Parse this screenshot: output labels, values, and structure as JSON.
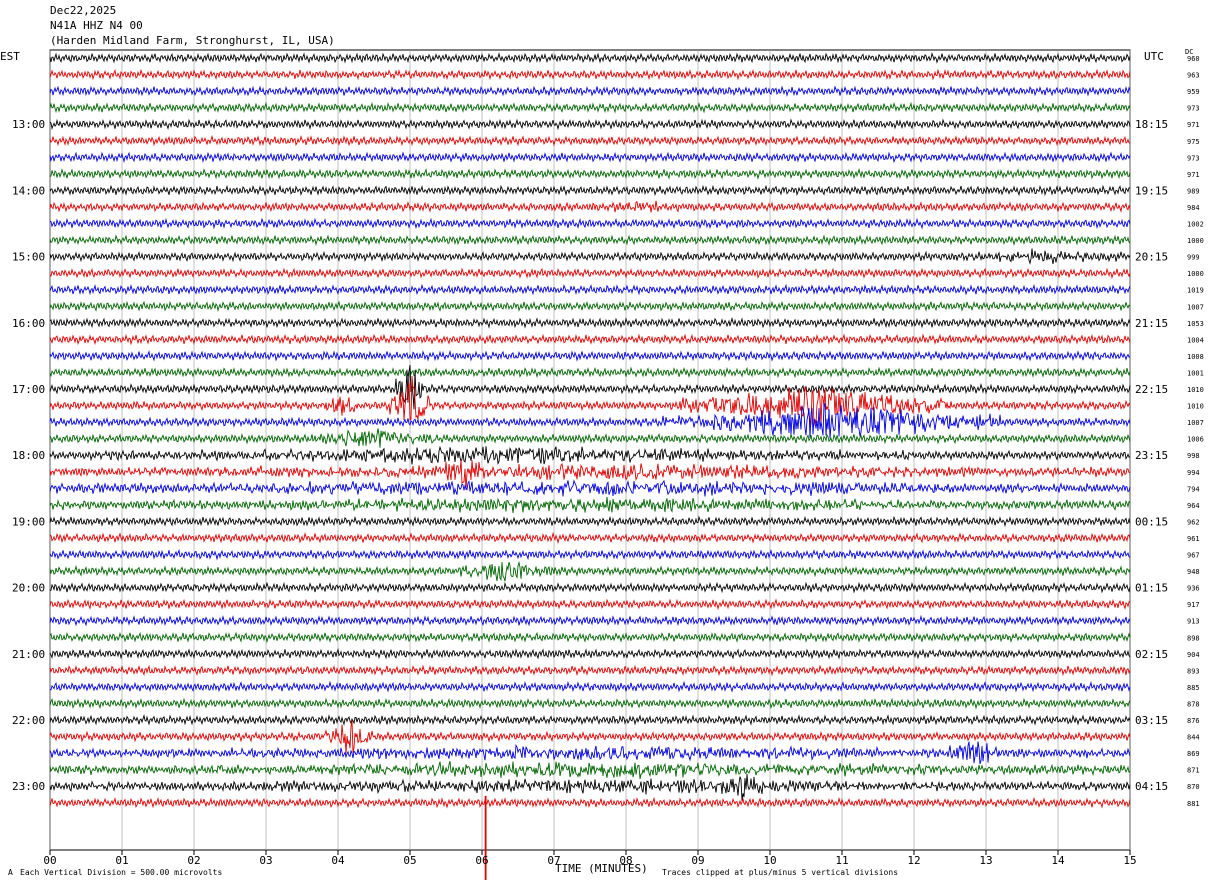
{
  "header": {
    "date": "Dec22,2025",
    "station": "N41A HHZ N4 00",
    "location": "(Harden Midland Farm, Stronghurst, IL, USA)"
  },
  "left_axis_label": "EST",
  "right_axis_label": "UTC",
  "dc_label": "DC",
  "footer": {
    "scale_note": "Each Vertical Division =  500.00 microvolts",
    "clip_note": "Traces clipped at plus/minus 5 vertical divisions",
    "corner_mark": "A"
  },
  "chart_data": {
    "type": "line",
    "title": "",
    "xlabel": "TIME (MINUTES)",
    "ylabel": "",
    "xlim": [
      0,
      15
    ],
    "x_ticks": [
      "00",
      "01",
      "02",
      "03",
      "04",
      "05",
      "06",
      "07",
      "08",
      "09",
      "10",
      "11",
      "12",
      "13",
      "14",
      "15"
    ],
    "traces_per_hour": 4,
    "minutes_per_trace": 15,
    "trace_colors": [
      "#000000",
      "#e00000",
      "#0000e0",
      "#006400"
    ],
    "left_time_labels": [
      {
        "trace": 4,
        "label": "13:00"
      },
      {
        "trace": 8,
        "label": "14:00"
      },
      {
        "trace": 12,
        "label": "15:00"
      },
      {
        "trace": 16,
        "label": "16:00"
      },
      {
        "trace": 20,
        "label": "17:00"
      },
      {
        "trace": 24,
        "label": "18:00"
      },
      {
        "trace": 28,
        "label": "19:00"
      },
      {
        "trace": 32,
        "label": "20:00"
      },
      {
        "trace": 36,
        "label": "21:00"
      },
      {
        "trace": 40,
        "label": "22:00"
      },
      {
        "trace": 44,
        "label": "23:00"
      }
    ],
    "right_time_labels": [
      {
        "trace": 4,
        "label": "18:15"
      },
      {
        "trace": 8,
        "label": "19:15"
      },
      {
        "trace": 12,
        "label": "20:15"
      },
      {
        "trace": 16,
        "label": "21:15"
      },
      {
        "trace": 20,
        "label": "22:15"
      },
      {
        "trace": 24,
        "label": "23:15"
      },
      {
        "trace": 28,
        "label": "00:15"
      },
      {
        "trace": 32,
        "label": "01:15"
      },
      {
        "trace": 36,
        "label": "02:15"
      },
      {
        "trace": 40,
        "label": "03:15"
      },
      {
        "trace": 44,
        "label": "04:15"
      }
    ],
    "dc_values": [
      "960",
      "963",
      "959",
      "973",
      "971",
      "975",
      "973",
      "971",
      "989",
      "984",
      "1002",
      "1000",
      "999",
      "1000",
      "1019",
      "1007",
      "1053",
      "1004",
      "1008",
      "1001",
      "1010",
      "1010",
      "1007",
      "1006",
      "998",
      "994",
      "794",
      "964",
      "962",
      "961",
      "967",
      "948",
      "936",
      "917",
      "913",
      "898",
      "904",
      "893",
      "885",
      "878",
      "876",
      "844",
      "869",
      "871",
      "870",
      "881"
    ],
    "events": [
      {
        "trace": 20,
        "start_min": 4.8,
        "end_min": 5.2,
        "amp": 28
      },
      {
        "trace": 21,
        "start_min": 3.8,
        "end_min": 4.3,
        "amp": 12
      },
      {
        "trace": 21,
        "start_min": 4.7,
        "end_min": 5.3,
        "amp": 30
      },
      {
        "trace": 22,
        "start_min": 8.5,
        "end_min": 13.2,
        "amp": 18
      },
      {
        "trace": 21,
        "start_min": 8.7,
        "end_min": 12.5,
        "amp": 20
      },
      {
        "trace": 23,
        "start_min": 3.6,
        "end_min": 5.4,
        "amp": 10
      },
      {
        "trace": 24,
        "start_min": 0.5,
        "end_min": 12.0,
        "amp": 7
      },
      {
        "trace": 25,
        "start_min": 5.5,
        "end_min": 6.0,
        "amp": 20
      },
      {
        "trace": 25,
        "start_min": 0.0,
        "end_min": 15.0,
        "amp": 6
      },
      {
        "trace": 26,
        "start_min": 0.0,
        "end_min": 15.0,
        "amp": 6
      },
      {
        "trace": 27,
        "start_min": 0.0,
        "end_min": 15.0,
        "amp": 5
      },
      {
        "trace": 31,
        "start_min": 5.6,
        "end_min": 7.0,
        "amp": 9
      },
      {
        "trace": 41,
        "start_min": 3.8,
        "end_min": 4.5,
        "amp": 18
      },
      {
        "trace": 42,
        "start_min": 12.5,
        "end_min": 13.2,
        "amp": 16
      },
      {
        "trace": 42,
        "start_min": 0.0,
        "end_min": 15.0,
        "amp": 5
      },
      {
        "trace": 43,
        "start_min": 0.0,
        "end_min": 15.0,
        "amp": 6
      },
      {
        "trace": 44,
        "start_min": 9.3,
        "end_min": 9.9,
        "amp": 12
      },
      {
        "trace": 44,
        "start_min": 0.0,
        "end_min": 15.0,
        "amp": 5
      },
      {
        "trace": 12,
        "start_min": 12.5,
        "end_min": 15.0,
        "amp": 5
      },
      {
        "trace": 9,
        "start_min": 7.5,
        "end_min": 8.8,
        "amp": 4
      }
    ],
    "spike_markers": [
      {
        "trace": 47,
        "minute": 6.05,
        "color": "#e00000"
      }
    ],
    "grid": true,
    "vertical_gridlines_every_min": 1
  }
}
